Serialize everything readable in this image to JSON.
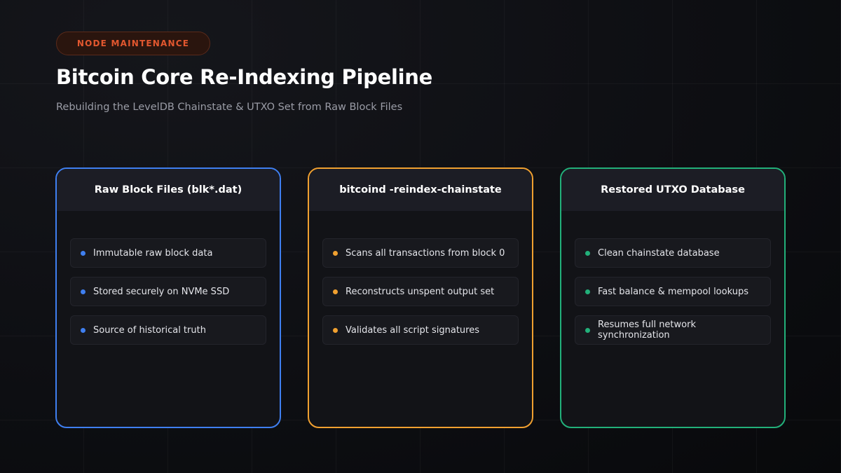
{
  "badge": "NODE MAINTENANCE",
  "title": "Bitcoin Core Re-Indexing Pipeline",
  "subtitle": "Rebuilding the LevelDB Chainstate & UTXO Set from Raw Block Files",
  "colors": {
    "blue": "#3f7ff0",
    "orange": "#f0a030",
    "green": "#22b07a",
    "badge_text": "#e2572f"
  },
  "cards": [
    {
      "title": "Raw Block Files (blk*.dat)",
      "items": [
        "Immutable raw block data",
        "Stored securely on NVMe SSD",
        "Source of historical truth"
      ]
    },
    {
      "title": "bitcoind -reindex-chainstate",
      "items": [
        "Scans all transactions from block 0",
        "Reconstructs unspent output set",
        "Validates all script signatures"
      ]
    },
    {
      "title": "Restored UTXO Database",
      "items": [
        "Clean chainstate database",
        "Fast balance & mempool lookups",
        "Resumes full network synchronization"
      ]
    }
  ]
}
